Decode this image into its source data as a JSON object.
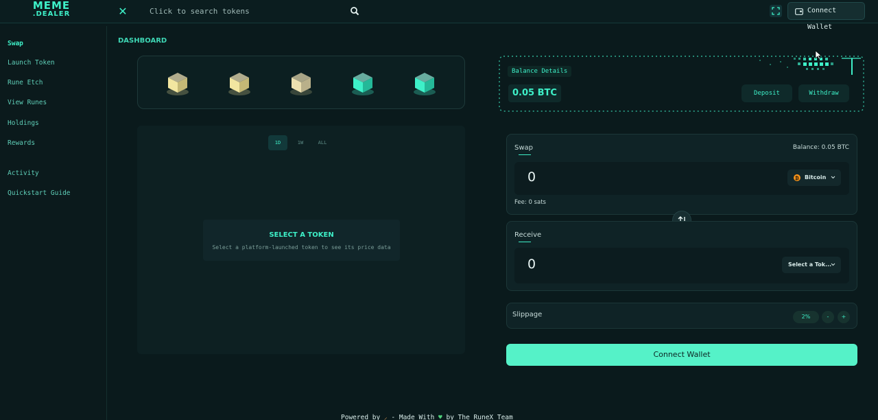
{
  "header": {
    "logo_line1": "MEME",
    "logo_line2": ".DEALER",
    "search_placeholder": "Click to search tokens",
    "connect_wallet": "Connect Wallet"
  },
  "sidebar": {
    "items": [
      {
        "label": "Swap"
      },
      {
        "label": "Launch Token"
      },
      {
        "label": "Rune Etch"
      },
      {
        "label": "View Runes"
      },
      {
        "label": "Holdings"
      },
      {
        "label": "Rewards"
      },
      {
        "label": "Activity"
      },
      {
        "label": "Quickstart Guide"
      }
    ]
  },
  "main": {
    "title": "DASHBOARD",
    "cube_colors": [
      "#f2e6a0",
      "#f2e6a0",
      "#f2e6a0",
      "#3ef0c8",
      "#3ef0c8"
    ],
    "range_tabs": [
      "1D",
      "1W",
      "ALL"
    ],
    "select_token_title": "SELECT A TOKEN",
    "select_token_sub": "Select a platform-launched token to see its price data"
  },
  "balance": {
    "label": "Balance Details",
    "value": "0.05 BTC",
    "deposit": "Deposit",
    "withdraw": "Withdraw"
  },
  "swap": {
    "label": "Swap",
    "balance": "Balance: 0.05  BTC",
    "amount": "0",
    "token": "Bitcoin",
    "fee": "Fee: 0 sats"
  },
  "receive": {
    "label": "Receive",
    "amount": "0",
    "token": "Select a Tok..."
  },
  "slippage": {
    "label": "Slippage",
    "value": "2%",
    "minus": "-",
    "plus": "+"
  },
  "connect_wallet_main": "Connect Wallet",
  "footer": {
    "text_before": "Powered by ",
    "text_middle": " - Made With ",
    "text_after": " by The RuneX Team"
  },
  "colors": {
    "accent": "#3ef0c8",
    "button": "#55f2c8",
    "background": "#0a1a1c"
  }
}
